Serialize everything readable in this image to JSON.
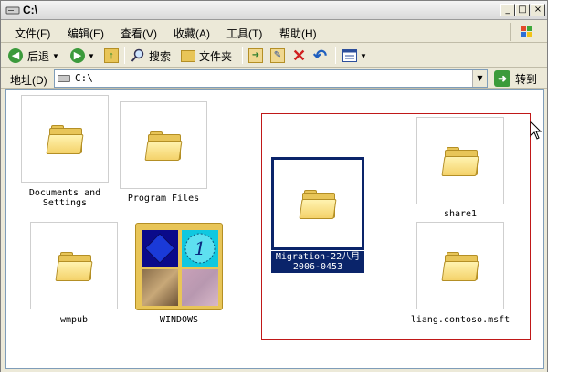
{
  "window": {
    "title": "C:\\",
    "controls": {
      "minimize": "_",
      "maximize": "□",
      "close": "×"
    }
  },
  "menu": {
    "items": [
      "文件(F)",
      "编辑(E)",
      "查看(V)",
      "收藏(A)",
      "工具(T)",
      "帮助(H)"
    ]
  },
  "toolbar": {
    "back_label": "后退",
    "search_label": "搜索",
    "folders_label": "文件夹"
  },
  "address": {
    "label": "地址(D)",
    "value": "C:\\",
    "go_label": "转到"
  },
  "files": [
    {
      "name_line1": "Documents and",
      "name_line2": "Settings"
    },
    {
      "name_line1": "Program Files",
      "name_line2": ""
    },
    {
      "name_line1": "share1",
      "name_line2": ""
    },
    {
      "name_line1": "Migration-22八月",
      "name_line2": "2006-0453",
      "selected": true
    },
    {
      "name_line1": "wmpub",
      "name_line2": ""
    },
    {
      "name_line1": "WINDOWS",
      "name_line2": ""
    },
    {
      "name_line1": "liang.contoso.msft",
      "name_line2": ""
    }
  ],
  "colors": {
    "selection_bg": "#0a246a",
    "selection_rect": "#c01818",
    "folder_yellow": "#e8c558"
  }
}
